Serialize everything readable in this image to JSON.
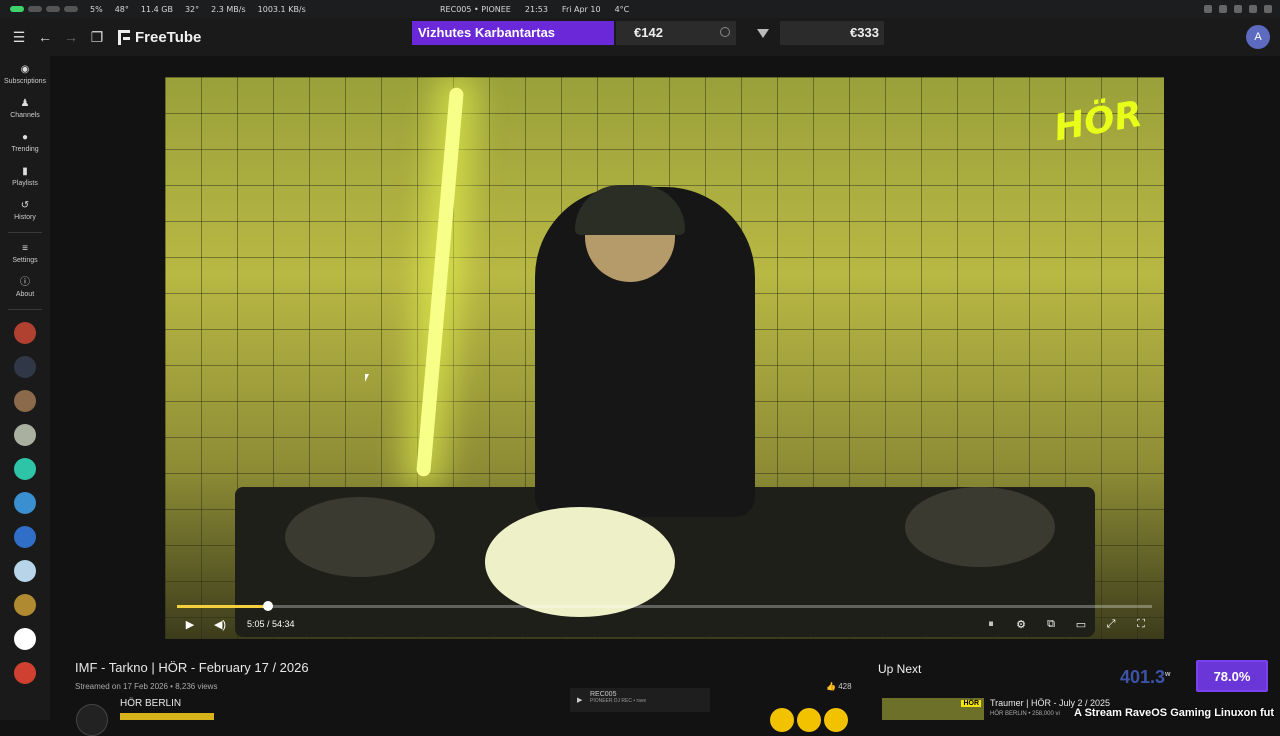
{
  "system_bar": {
    "cpu": "5%",
    "temp1": "48°",
    "ram": "11.4 GB",
    "temp2": "32°",
    "net_down": "2.3 MB/s",
    "net_up": "1003.1 KB/s",
    "media": "REC005 • PIONEE",
    "time": "21:53",
    "date": "Fri Apr 10",
    "weather": "4°C"
  },
  "header": {
    "app_name": "FreeTube",
    "banner_text": "Vizhutes Karbantartas",
    "price_left": "€142",
    "price_right": "€333",
    "avatar_letter": "A"
  },
  "sidebar": {
    "items": [
      {
        "label": "Subscriptions",
        "icon": "rss-icon"
      },
      {
        "label": "Channels",
        "icon": "channels-icon"
      },
      {
        "label": "Trending",
        "icon": "fire-icon"
      },
      {
        "label": "Playlists",
        "icon": "bookmark-icon"
      },
      {
        "label": "History",
        "icon": "history-icon"
      },
      {
        "label": "Settings",
        "icon": "sliders-icon"
      },
      {
        "label": "About",
        "icon": "info-icon"
      }
    ],
    "subscription_colors": [
      "#b04030",
      "#303848",
      "#8a6a4a",
      "#aab0a0",
      "#2ec4a8",
      "#3a8fd0",
      "#2f6fc8",
      "#b8d4e8",
      "#b08a30",
      "#ffffff",
      "#d04030"
    ]
  },
  "player": {
    "channel_logo": "HÖR",
    "time_display": "5:05 / 54:34",
    "progress_fraction": 0.093,
    "accent_color": "#f4d03f"
  },
  "video": {
    "title": "IMF - Tarkno | HÖR - February 17 / 2026",
    "meta": "Streamed on 17 Feb 2026 • 8,236 views",
    "channel": "HÖR BERLIN",
    "likes": "428"
  },
  "now_playing": {
    "title": "REC005",
    "subtitle": "PIONEER DJ REC • rave"
  },
  "up_next": {
    "heading": "Up Next",
    "item_title": "Traumer | HÖR - July 2 / 2025",
    "item_meta": "HÖR BERLIN • 258,000 vi",
    "thumb_badge": "HÖR"
  },
  "overlay": {
    "stat_value": "401.3",
    "stat_unit": "w",
    "stat_percent": "78.0%",
    "ticker": "A Stream RaveOS Gaming Linuxon fut"
  }
}
